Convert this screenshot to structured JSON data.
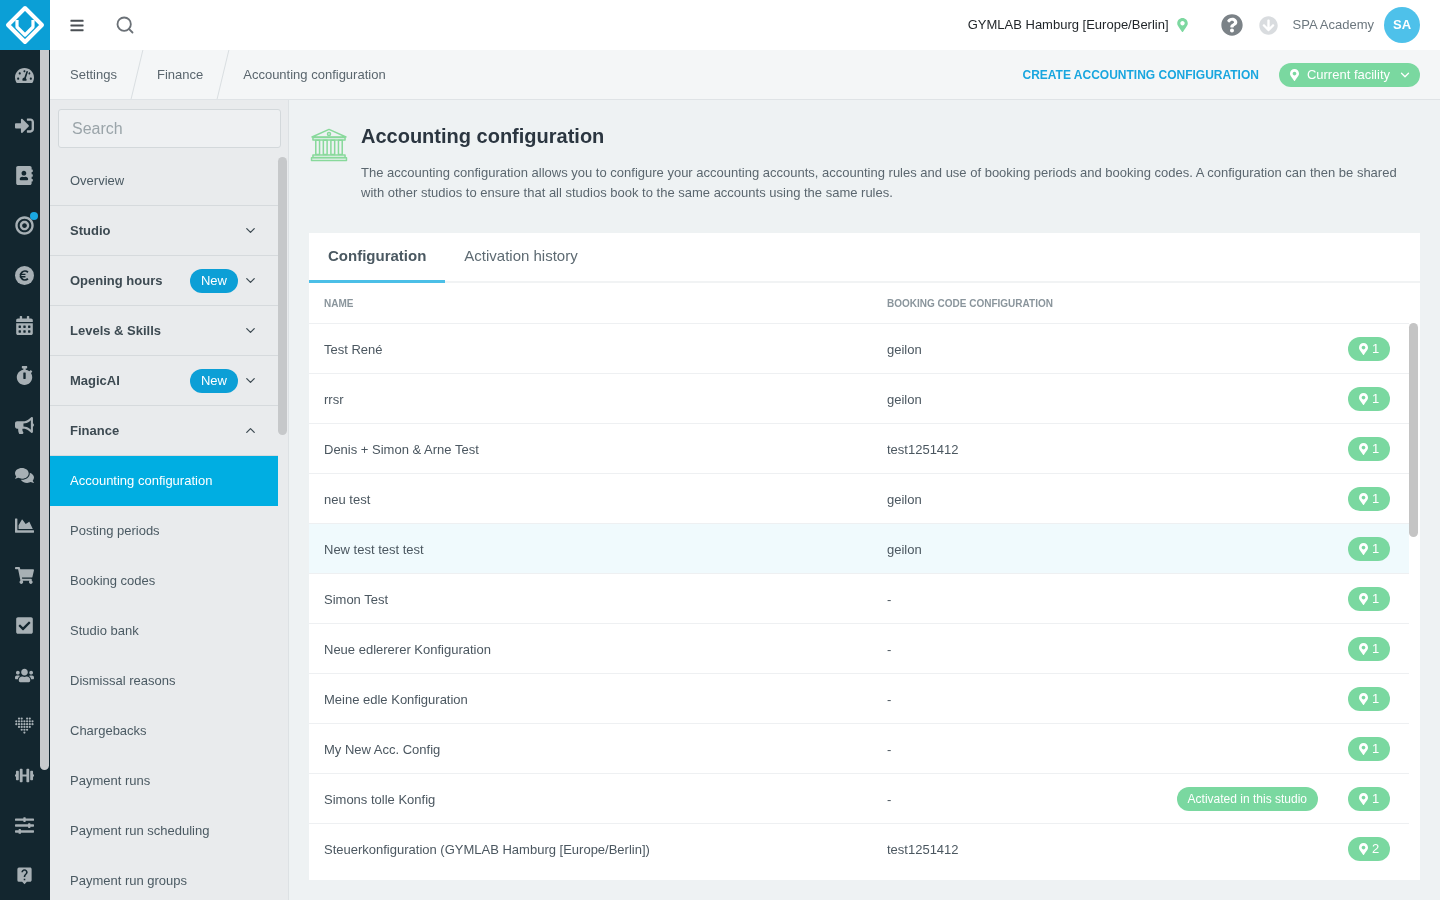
{
  "rail": [
    {
      "notification": false
    },
    {
      "notification": false
    },
    {
      "notification": false
    },
    {
      "notification": true
    },
    {
      "notification": false
    },
    {
      "notification": false
    },
    {
      "notification": false
    },
    {
      "notification": false
    },
    {
      "notification": false
    },
    {
      "notification": false
    },
    {
      "notification": false
    },
    {
      "notification": false
    },
    {
      "notification": false
    },
    {
      "notification": false
    },
    {
      "notification": false
    },
    {
      "notification": false
    },
    {
      "notification": false
    }
  ],
  "top_bar": {
    "facility": "GYMLAB Hamburg [Europe/Berlin]",
    "user": "SPA Academy",
    "avatar_initials": "SA"
  },
  "breadcrumbs": [
    "Settings",
    "Finance",
    "Accounting configuration"
  ],
  "actions": {
    "create_link": "CREATE ACCOUNTING CONFIGURATION",
    "facility_button": "Current facility"
  },
  "settings_menu": {
    "search": {
      "placeholder": "Search"
    },
    "items": [
      {
        "kind": "item",
        "label": "Overview",
        "selected": false
      },
      {
        "kind": "group",
        "label": "Studio",
        "expanded": false
      },
      {
        "kind": "group",
        "label": "Opening hours",
        "badge": "New",
        "expanded": false
      },
      {
        "kind": "group",
        "label": "Levels & Skills",
        "expanded": false
      },
      {
        "kind": "group",
        "label": "MagicAI",
        "badge": "New",
        "expanded": false
      },
      {
        "kind": "group",
        "label": "Finance",
        "expanded": true,
        "children": [
          {
            "label": "Accounting configuration",
            "selected": true
          },
          {
            "label": "Posting periods",
            "selected": false
          },
          {
            "label": "Booking codes",
            "selected": false
          },
          {
            "label": "Studio bank",
            "selected": false
          },
          {
            "label": "Dismissal reasons",
            "selected": false
          },
          {
            "label": "Chargebacks",
            "selected": false
          },
          {
            "label": "Payment runs",
            "selected": false
          },
          {
            "label": "Payment run scheduling",
            "selected": false
          },
          {
            "label": "Payment run groups",
            "selected": false
          }
        ]
      }
    ]
  },
  "page": {
    "title": "Accounting configuration",
    "description": "The accounting configuration allows you to configure your accounting accounts, accounting rules and use of booking periods and booking codes. A configuration can then be shared with other studios to ensure that all studios book to the same accounts using the same rules."
  },
  "tabs": [
    {
      "label": "Configuration",
      "selected": true
    },
    {
      "label": "Activation history",
      "selected": false
    }
  ],
  "table": {
    "columns": [
      "NAME",
      "BOOKING CODE CONFIGURATION"
    ],
    "rows": [
      {
        "name": "Test René",
        "booking_code": "geilon",
        "locations": "1",
        "hovered": false
      },
      {
        "name": "rrsr",
        "booking_code": "geilon",
        "locations": "1",
        "hovered": false
      },
      {
        "name": "Denis + Simon & Arne Test",
        "booking_code": "test1251412",
        "locations": "1",
        "hovered": false
      },
      {
        "name": "neu test",
        "booking_code": "geilon",
        "locations": "1",
        "hovered": false
      },
      {
        "name": "New test test test",
        "booking_code": "geilon",
        "locations": "1",
        "hovered": true
      },
      {
        "name": "Simon Test",
        "booking_code": "-",
        "locations": "1",
        "hovered": false
      },
      {
        "name": "Neue edlererer Konfiguration",
        "booking_code": "-",
        "locations": "1",
        "hovered": false
      },
      {
        "name": "Meine edle Konfiguration",
        "booking_code": "-",
        "locations": "1",
        "hovered": false
      },
      {
        "name": "My New Acc. Config",
        "booking_code": "-",
        "locations": "1",
        "hovered": false
      },
      {
        "name": "Simons tolle Konfig",
        "booking_code": "-",
        "badge": "Activated in this studio",
        "locations": "1",
        "hovered": false
      },
      {
        "name": "Steuerkonfiguration (GYMLAB Hamburg [Europe/Berlin])",
        "booking_code": "test1251412",
        "locations": "2",
        "hovered": false
      }
    ]
  }
}
